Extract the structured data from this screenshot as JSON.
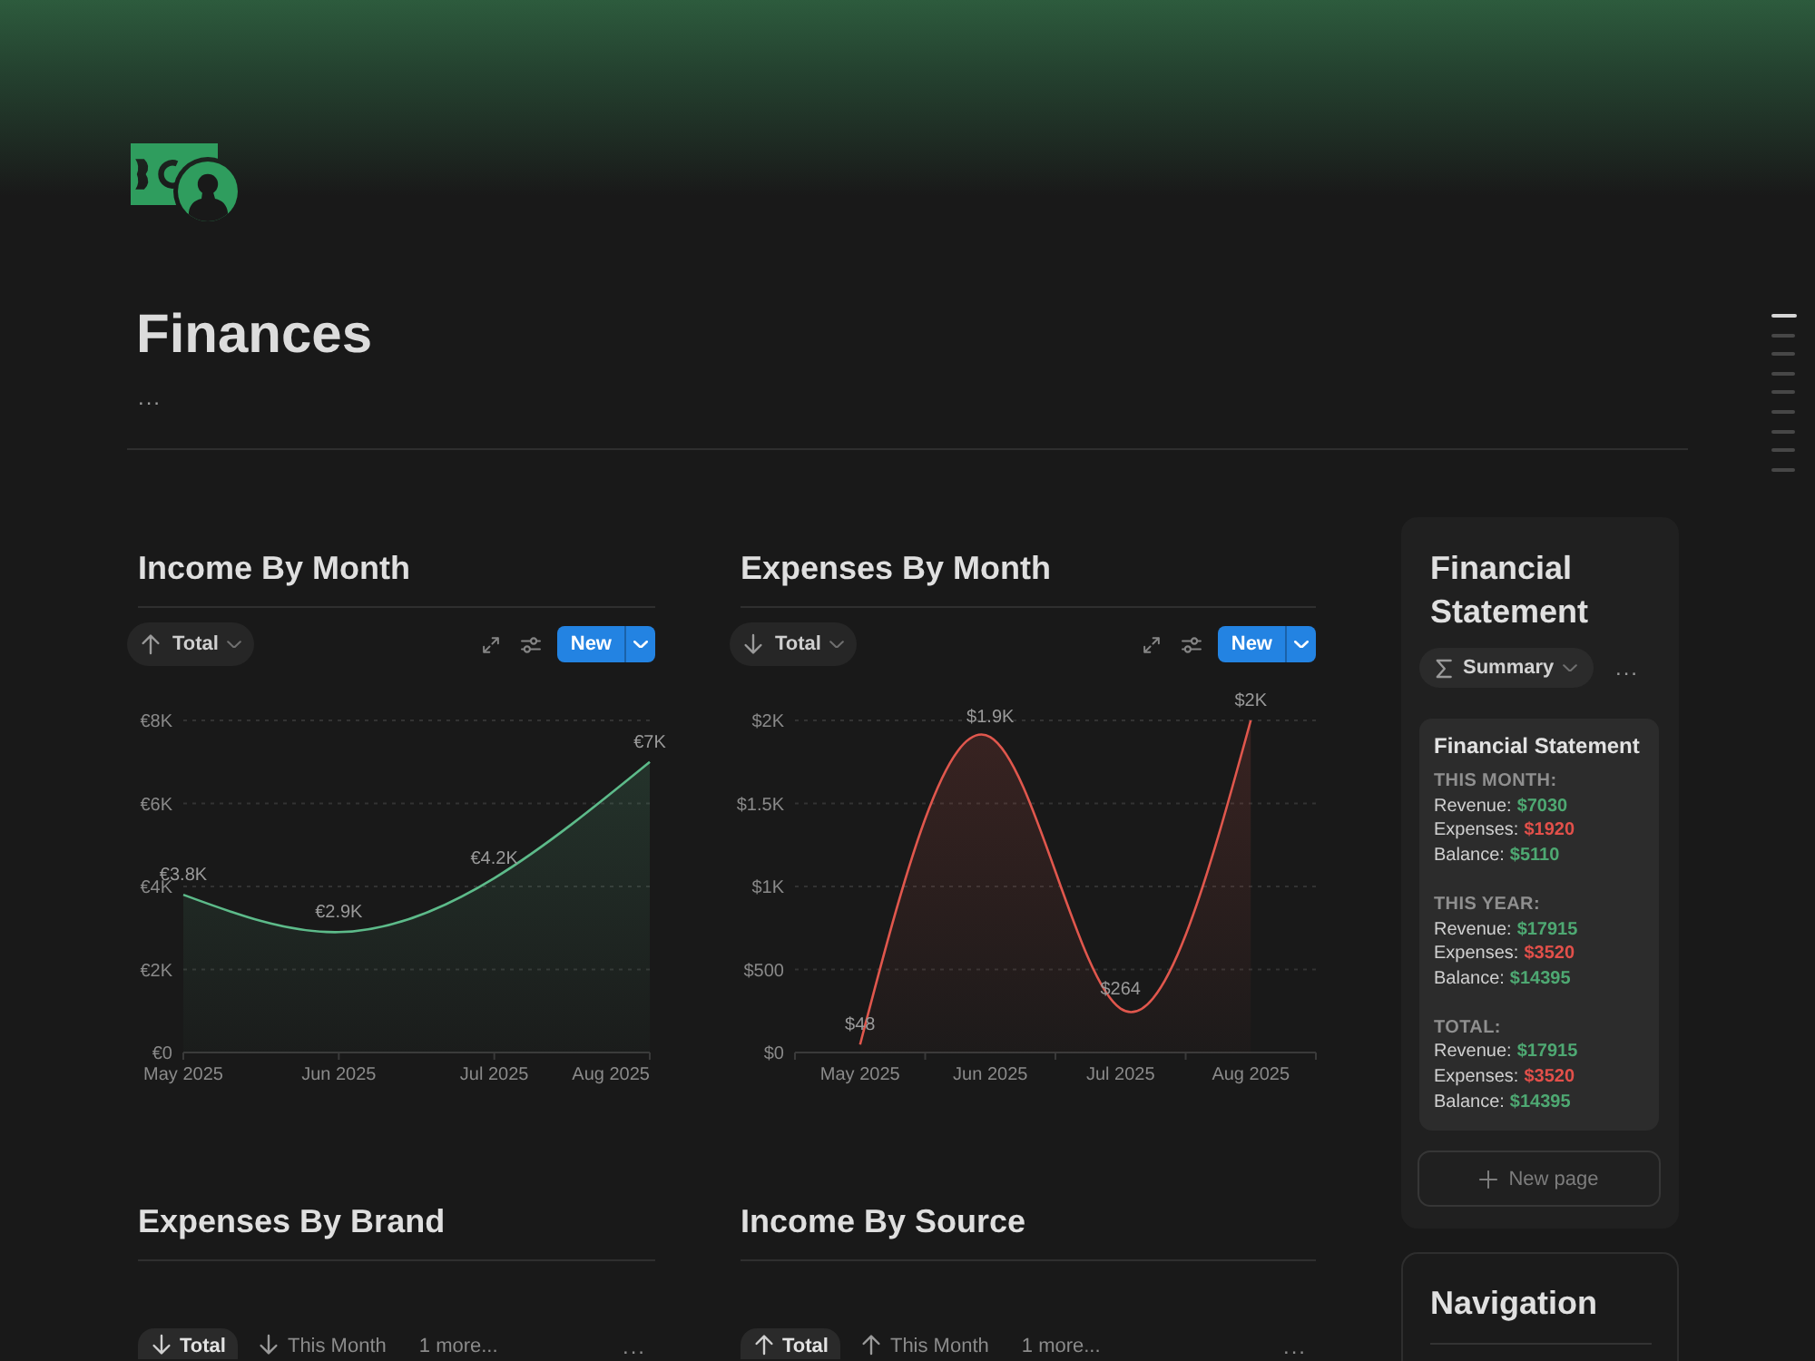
{
  "header": {
    "title": "Finances",
    "menu": "..."
  },
  "outline": [
    {
      "selected": true
    },
    {
      "selected": false
    },
    {
      "selected": false
    },
    {
      "selected": false
    },
    {
      "selected": false
    },
    {
      "selected": false
    },
    {
      "selected": false
    },
    {
      "selected": false
    },
    {
      "selected": false
    }
  ],
  "sections": [
    {
      "kind": "chart",
      "title": "Income By Month",
      "view": {
        "kind": "up",
        "label": "Total"
      },
      "new_button": "New",
      "chart_data": {
        "type": "area",
        "categories": [
          "May 2025",
          "Jun 2025",
          "Jul 2025",
          "Aug 2025"
        ],
        "values": [
          3800,
          2900,
          4200,
          7000
        ],
        "color": "#5dbb8a",
        "ylim": [
          0,
          8000
        ],
        "yticks": [
          {
            "value": 0,
            "label": "€0"
          },
          {
            "value": 2000,
            "label": "€2K"
          },
          {
            "value": 4000,
            "label": "€4K"
          },
          {
            "value": 6000,
            "label": "€6K"
          },
          {
            "value": 8000,
            "label": "€8K"
          }
        ],
        "grid": true,
        "value_labels": [
          "€3.8K",
          "€2.9K",
          "€4.2K",
          "€7K"
        ]
      }
    },
    {
      "kind": "chart",
      "title": "Expenses By Month",
      "view": {
        "kind": "down",
        "label": "Total"
      },
      "new_button": "New",
      "chart_data": {
        "type": "area",
        "categories": [
          "May 2025",
          "Jun 2025",
          "Jul 2025",
          "Aug 2025"
        ],
        "values": [
          48,
          1900,
          264,
          2000
        ],
        "color": "#e0574d",
        "ylim": [
          0,
          2000
        ],
        "yticks": [
          {
            "value": 0,
            "label": "$0"
          },
          {
            "value": 500,
            "label": "$500"
          },
          {
            "value": 1000,
            "label": "$1K"
          },
          {
            "value": 1500,
            "label": "$1.5K"
          },
          {
            "value": 2000,
            "label": "$2K"
          }
        ],
        "grid": true,
        "value_labels": [
          "$48",
          "$1.9K",
          "$264",
          "$2K"
        ]
      }
    },
    {
      "kind": "views",
      "title": "Expenses By Brand",
      "views": [
        {
          "kind": "down",
          "label": "Total",
          "selected": true
        },
        {
          "kind": "down",
          "label": "This Month",
          "selected": false
        },
        {
          "kind": "more",
          "label": "1 more...",
          "selected": false
        }
      ],
      "menu": "..."
    },
    {
      "kind": "views",
      "title": "Income By Source",
      "views": [
        {
          "kind": "up",
          "label": "Total",
          "selected": true
        },
        {
          "kind": "up",
          "label": "This Month",
          "selected": false
        },
        {
          "kind": "more",
          "label": "1 more...",
          "selected": false
        }
      ],
      "menu": "..."
    }
  ],
  "statement": {
    "title": "Financial Statement",
    "view": {
      "label": "Summary"
    },
    "menu": "...",
    "card": {
      "title": "Financial Statement",
      "groups": [
        {
          "heading": "THIS MONTH:",
          "lines": [
            {
              "label": "Revenue:",
              "amount": "$7030",
              "color": "#4ea872"
            },
            {
              "label": "Expenses:",
              "amount": "$1920",
              "color": "#e2504a"
            },
            {
              "label": "Balance:",
              "amount": "$5110",
              "color": "#4ea872"
            }
          ]
        },
        {
          "heading": "THIS YEAR:",
          "lines": [
            {
              "label": "Revenue:",
              "amount": "$17915",
              "color": "#4ea872"
            },
            {
              "label": "Expenses:",
              "amount": "$3520",
              "color": "#e2504a"
            },
            {
              "label": "Balance:",
              "amount": "$14395",
              "color": "#4ea872"
            }
          ]
        },
        {
          "heading": "TOTAL:",
          "lines": [
            {
              "label": "Revenue:",
              "amount": "$17915",
              "color": "#4ea872"
            },
            {
              "label": "Expenses:",
              "amount": "$3520",
              "color": "#e2504a"
            },
            {
              "label": "Balance:",
              "amount": "$14395",
              "color": "#4ea872"
            }
          ]
        }
      ]
    },
    "new_page": "New page"
  },
  "navigation": {
    "title": "Navigation"
  }
}
